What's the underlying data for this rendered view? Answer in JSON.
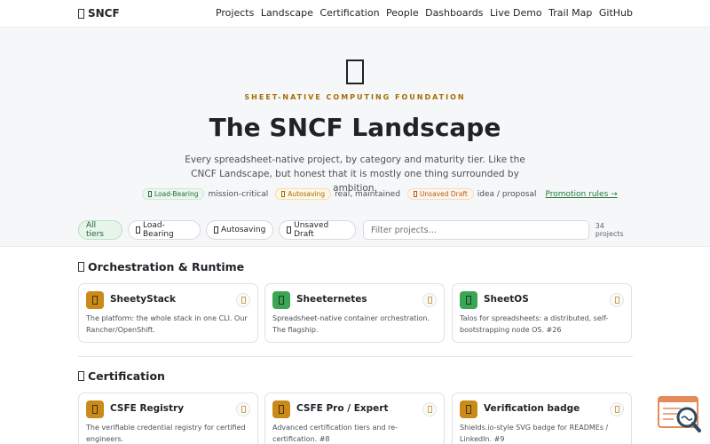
{
  "nav": {
    "brand": "SNCF",
    "links": [
      "Projects",
      "Landscape",
      "Certification",
      "People",
      "Dashboards",
      "Live Demo",
      "Trail Map",
      "GitHub"
    ]
  },
  "hero": {
    "eyebrow": "SHEET-NATIVE COMPUTING FOUNDATION",
    "title": "The SNCF Landscape",
    "subtitle": "Every spreadsheet-native project, by category and maturity tier. Like the CNCF Landscape, but honest that it is mostly one thing surrounded by ambition.",
    "legend": [
      {
        "tier": "Load-Bearing",
        "desc": "mission-critical"
      },
      {
        "tier": "Autosaving",
        "desc": "real, maintained"
      },
      {
        "tier": "Unsaved Draft",
        "desc": "idea / proposal"
      }
    ],
    "promotion_link": "Promotion rules →"
  },
  "filters": {
    "chips": [
      "All tiers",
      "Load-Bearing",
      "Autosaving",
      "Unsaved Draft"
    ],
    "active": "All tiers",
    "search_placeholder": "Filter projects…",
    "count": "34 projects"
  },
  "sections": [
    {
      "title": "Orchestration & Runtime",
      "cards": [
        {
          "name": "SheetyStack",
          "desc": "The platform: the whole stack in one CLI. Our Rancher/OpenShift.",
          "color": "#c98a1a"
        },
        {
          "name": "Sheeternetes",
          "desc": "Spreadsheet-native container orchestration. The flagship.",
          "color": "#3aa655"
        },
        {
          "name": "SheetOS",
          "desc": "Talos for spreadsheets: a distributed, self-bootstrapping node OS. #26",
          "color": "#3aa655"
        }
      ]
    },
    {
      "title": "Certification",
      "cards": [
        {
          "name": "CSFE Registry",
          "desc": "The verifiable credential registry for certified engineers.",
          "color": "#c98a1a"
        },
        {
          "name": "CSFE Pro / Expert",
          "desc": "Advanced certification tiers and re-certification. #8",
          "color": "#c98a1a"
        },
        {
          "name": "Verification badge",
          "desc": "Shields.io-style SVG badge for READMEs / LinkedIn. #9",
          "color": "#c98a1a"
        }
      ]
    }
  ],
  "colors": {
    "accent_green": "#227a3f",
    "eyebrow": "#a56d00",
    "hero_bg": "#f6f7f8"
  }
}
